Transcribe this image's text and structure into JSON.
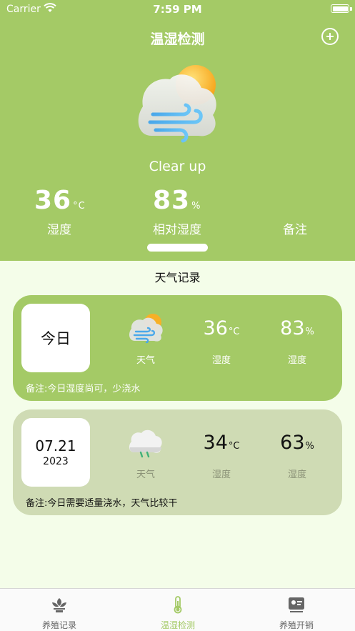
{
  "status_bar": {
    "carrier": "Carrier",
    "time": "7:59 PM"
  },
  "header": {
    "title": "温湿检测",
    "condition": "Clear up",
    "temperature": {
      "value": "36",
      "unit": "°C",
      "label": "湿度"
    },
    "humidity": {
      "value": "83",
      "unit": "%",
      "label": "相对湿度"
    },
    "note_label": "备注"
  },
  "records": {
    "title": "天气记录",
    "items": [
      {
        "date_main": "今日",
        "date_year": "",
        "weather_label": "天气",
        "temp_value": "36",
        "temp_unit": "°C",
        "temp_label": "湿度",
        "hum_value": "83",
        "hum_unit": "%",
        "hum_label": "湿度",
        "note": "备注:今日湿度尚可，少浇水"
      },
      {
        "date_main": "07.21",
        "date_year": "2023",
        "weather_label": "天气",
        "temp_value": "34",
        "temp_unit": "°C",
        "temp_label": "湿度",
        "hum_value": "63",
        "hum_unit": "%",
        "hum_label": "湿度",
        "note": "备注:今日需要适量浇水，天气比较干"
      }
    ]
  },
  "tabbar": {
    "tabs": [
      {
        "label": "养殖记录",
        "icon": "plant-icon",
        "active": false
      },
      {
        "label": "温湿检测",
        "icon": "thermometer-icon",
        "active": true
      },
      {
        "label": "养殖开销",
        "icon": "wallet-icon",
        "active": false
      }
    ]
  },
  "colors": {
    "accent": "#a4ca66",
    "card_muted": "#cfdbb4",
    "background": "#f4fde9"
  }
}
